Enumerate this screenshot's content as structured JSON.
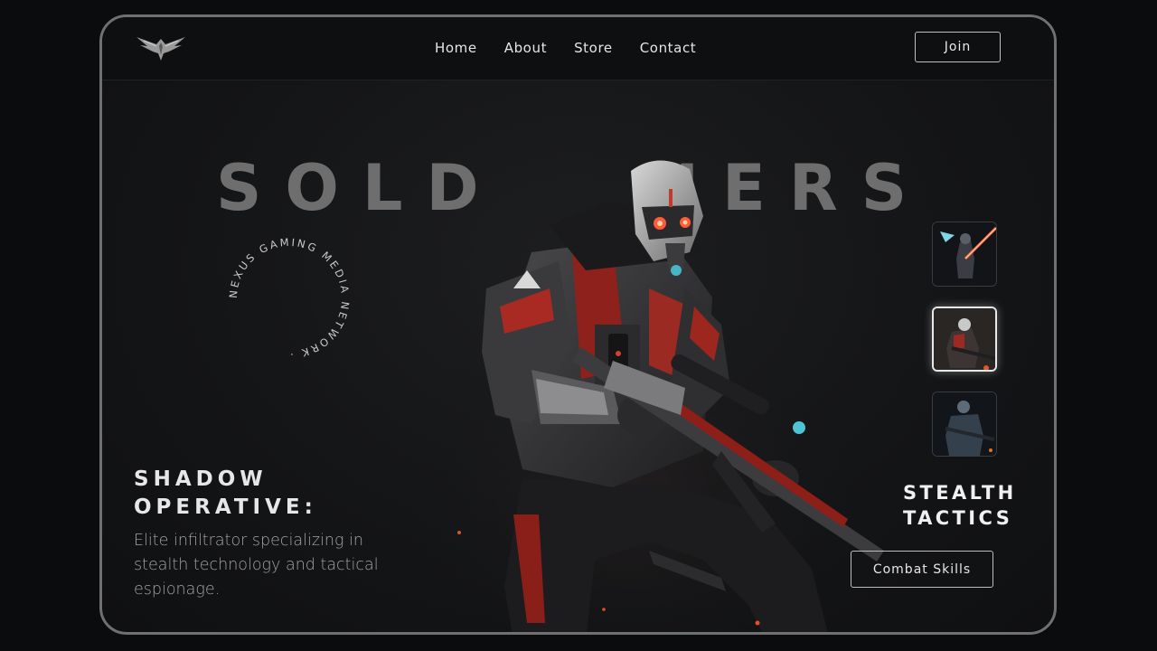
{
  "nav": {
    "items": [
      {
        "label": "Home"
      },
      {
        "label": "About"
      },
      {
        "label": "Store"
      },
      {
        "label": "Contact"
      }
    ],
    "join_label": "Join"
  },
  "hero": {
    "title_left": "SOLD",
    "title_right": "IERS",
    "ring_text": "NEXUS GAMING MEDIA NETWORK ·"
  },
  "operative": {
    "title_line1": "SHADOW",
    "title_line2": "OPERATIVE:",
    "description": "Elite infiltrator specializing in stealth technology and tactical espionage."
  },
  "side": {
    "title_line1": "STEALTH",
    "title_line2": "TACTICS",
    "button_label": "Combat Skills"
  },
  "thumbnails": [
    {
      "name": "laser-blade-warrior",
      "selected": false
    },
    {
      "name": "shadow-operative",
      "selected": true
    },
    {
      "name": "blue-armored-soldier",
      "selected": false
    }
  ],
  "colors": {
    "accent_red": "#c8332b",
    "title_gray": "#6e6e6e",
    "frame_border": "#6f7072"
  }
}
